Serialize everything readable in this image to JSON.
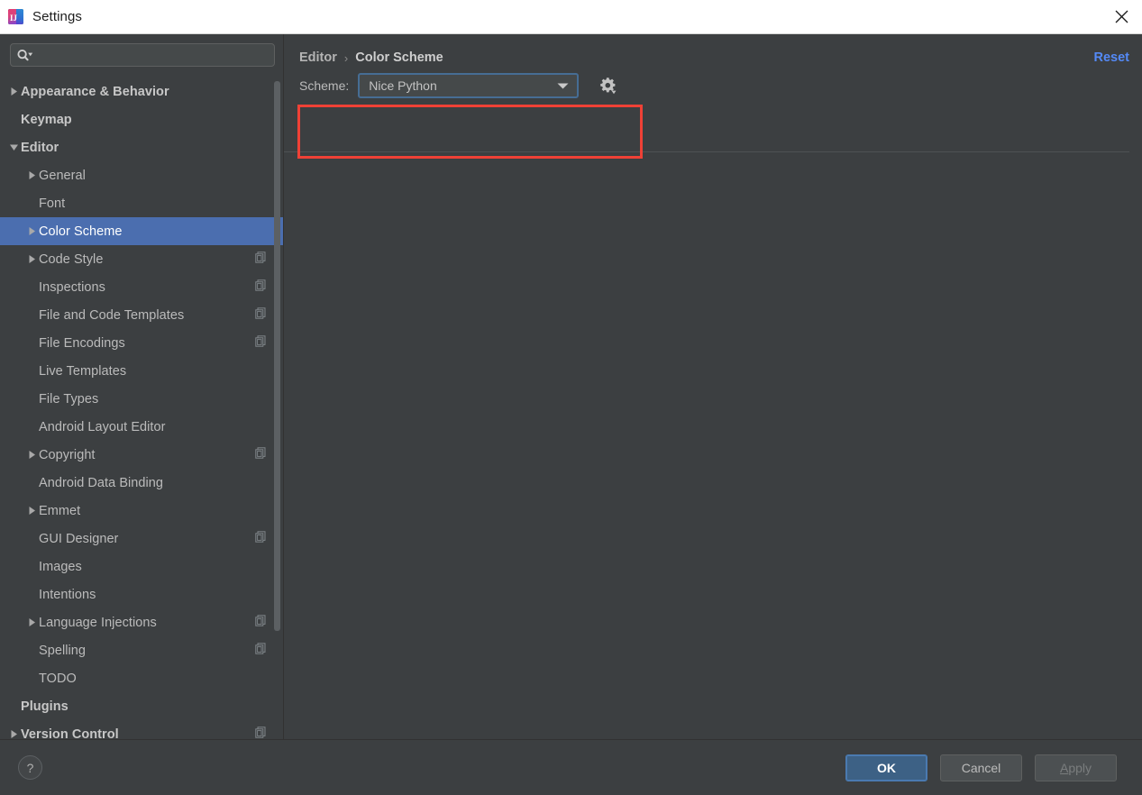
{
  "window": {
    "title": "Settings",
    "logo_icon": "intellij-idea-logo",
    "close_icon": "close-icon"
  },
  "search": {
    "value": "",
    "placeholder": "",
    "icon": "search-icon",
    "dropdown_icon": "chevron-down-icon"
  },
  "sidebar": {
    "items": [
      {
        "label": "Appearance & Behavior",
        "depth": 0,
        "arrow": "collapsed",
        "bold": true,
        "selected": false,
        "scope_icon": false
      },
      {
        "label": "Keymap",
        "depth": 0,
        "arrow": "none",
        "bold": true,
        "selected": false,
        "scope_icon": false
      },
      {
        "label": "Editor",
        "depth": 0,
        "arrow": "expanded",
        "bold": true,
        "selected": false,
        "scope_icon": false
      },
      {
        "label": "General",
        "depth": 1,
        "arrow": "collapsed",
        "bold": false,
        "selected": false,
        "scope_icon": false
      },
      {
        "label": "Font",
        "depth": 1,
        "arrow": "none",
        "bold": false,
        "selected": false,
        "scope_icon": false
      },
      {
        "label": "Color Scheme",
        "depth": 1,
        "arrow": "collapsed",
        "bold": false,
        "selected": true,
        "scope_icon": false
      },
      {
        "label": "Code Style",
        "depth": 1,
        "arrow": "collapsed",
        "bold": false,
        "selected": false,
        "scope_icon": true
      },
      {
        "label": "Inspections",
        "depth": 1,
        "arrow": "none",
        "bold": false,
        "selected": false,
        "scope_icon": true
      },
      {
        "label": "File and Code Templates",
        "depth": 1,
        "arrow": "none",
        "bold": false,
        "selected": false,
        "scope_icon": true
      },
      {
        "label": "File Encodings",
        "depth": 1,
        "arrow": "none",
        "bold": false,
        "selected": false,
        "scope_icon": true
      },
      {
        "label": "Live Templates",
        "depth": 1,
        "arrow": "none",
        "bold": false,
        "selected": false,
        "scope_icon": false
      },
      {
        "label": "File Types",
        "depth": 1,
        "arrow": "none",
        "bold": false,
        "selected": false,
        "scope_icon": false
      },
      {
        "label": "Android Layout Editor",
        "depth": 1,
        "arrow": "none",
        "bold": false,
        "selected": false,
        "scope_icon": false
      },
      {
        "label": "Copyright",
        "depth": 1,
        "arrow": "collapsed",
        "bold": false,
        "selected": false,
        "scope_icon": true
      },
      {
        "label": "Android Data Binding",
        "depth": 1,
        "arrow": "none",
        "bold": false,
        "selected": false,
        "scope_icon": false
      },
      {
        "label": "Emmet",
        "depth": 1,
        "arrow": "collapsed",
        "bold": false,
        "selected": false,
        "scope_icon": false
      },
      {
        "label": "GUI Designer",
        "depth": 1,
        "arrow": "none",
        "bold": false,
        "selected": false,
        "scope_icon": true
      },
      {
        "label": "Images",
        "depth": 1,
        "arrow": "none",
        "bold": false,
        "selected": false,
        "scope_icon": false
      },
      {
        "label": "Intentions",
        "depth": 1,
        "arrow": "none",
        "bold": false,
        "selected": false,
        "scope_icon": false
      },
      {
        "label": "Language Injections",
        "depth": 1,
        "arrow": "collapsed",
        "bold": false,
        "selected": false,
        "scope_icon": true
      },
      {
        "label": "Spelling",
        "depth": 1,
        "arrow": "none",
        "bold": false,
        "selected": false,
        "scope_icon": true
      },
      {
        "label": "TODO",
        "depth": 1,
        "arrow": "none",
        "bold": false,
        "selected": false,
        "scope_icon": false
      },
      {
        "label": "Plugins",
        "depth": 0,
        "arrow": "none",
        "bold": true,
        "selected": false,
        "scope_icon": false
      },
      {
        "label": "Version Control",
        "depth": 0,
        "arrow": "collapsed",
        "bold": true,
        "selected": false,
        "scope_icon": true
      }
    ]
  },
  "main": {
    "breadcrumb": {
      "parent": "Editor",
      "separator": "›",
      "current": "Color Scheme"
    },
    "reset_label": "Reset",
    "scheme": {
      "label": "Scheme:",
      "value": "Nice Python",
      "arrow_icon": "chevron-down-icon",
      "gear_icon": "gear-icon"
    }
  },
  "footer": {
    "help_label": "?",
    "help_icon": "help-icon",
    "ok_label": "OK",
    "cancel_label": "Cancel",
    "apply_label": "Apply",
    "apply_mnemonic": "A",
    "apply_rest": "pply"
  },
  "colors": {
    "window_bg": "#3c3f41",
    "titlebar_bg": "#ffffff",
    "selection_blue": "#4b6eaf",
    "link_blue": "#548af7",
    "primary_button": "#3d6185",
    "annotation_red": "#ef4136",
    "field_bg": "#45494a",
    "text": "#bbbbbb"
  }
}
